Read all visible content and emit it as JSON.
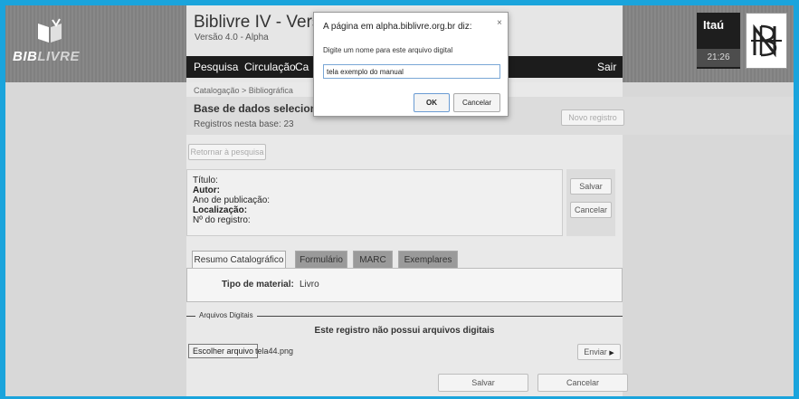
{
  "logo": {
    "text_bold": "BIB",
    "text_light": "LIVRE"
  },
  "app": {
    "title": "Biblivre IV - Versão",
    "version": "Versão 4.0 - Alpha"
  },
  "nav": {
    "items": [
      "Pesquisa",
      "Circulação",
      "Ca"
    ],
    "logout": "Sair"
  },
  "user": {
    "name": "Itaú",
    "clock": "21:26"
  },
  "breadcrumb": "Catalogação > Bibliográfica",
  "database": {
    "title": "Base de dados selecionad",
    "count": "Registros nesta base: 23",
    "new_record_button": "Novo registro"
  },
  "return_button": "Retornar à pesquisa",
  "fields": {
    "title": "Título:",
    "author": "Autor:",
    "year": "Ano de publicação:",
    "location": "Localização:",
    "record_number": "Nº do registro:"
  },
  "side_buttons": {
    "save": "Salvar",
    "cancel": "Cancelar"
  },
  "tabs": [
    "Resumo Catalográfico",
    "Formulário",
    "MARC",
    "Exemplares"
  ],
  "material": {
    "label": "Tipo de material:",
    "value": "Livro"
  },
  "digital_files": {
    "legend": "Arquivos Digitais",
    "empty_message": "Este registro não possui arquivos digitais",
    "choose_button": "Escolher arquivo",
    "chosen_file": "tela44.png",
    "send_button": "Enviar"
  },
  "bottom_buttons": {
    "save": "Salvar",
    "cancel": "Cancelar"
  },
  "dialog": {
    "title": "A página em alpha.biblivre.org.br diz:",
    "close": "×",
    "prompt": "Digite um nome para este arquivo digital",
    "input_value": "tela exemplo do manual",
    "ok": "OK",
    "cancel": "Cancelar"
  }
}
